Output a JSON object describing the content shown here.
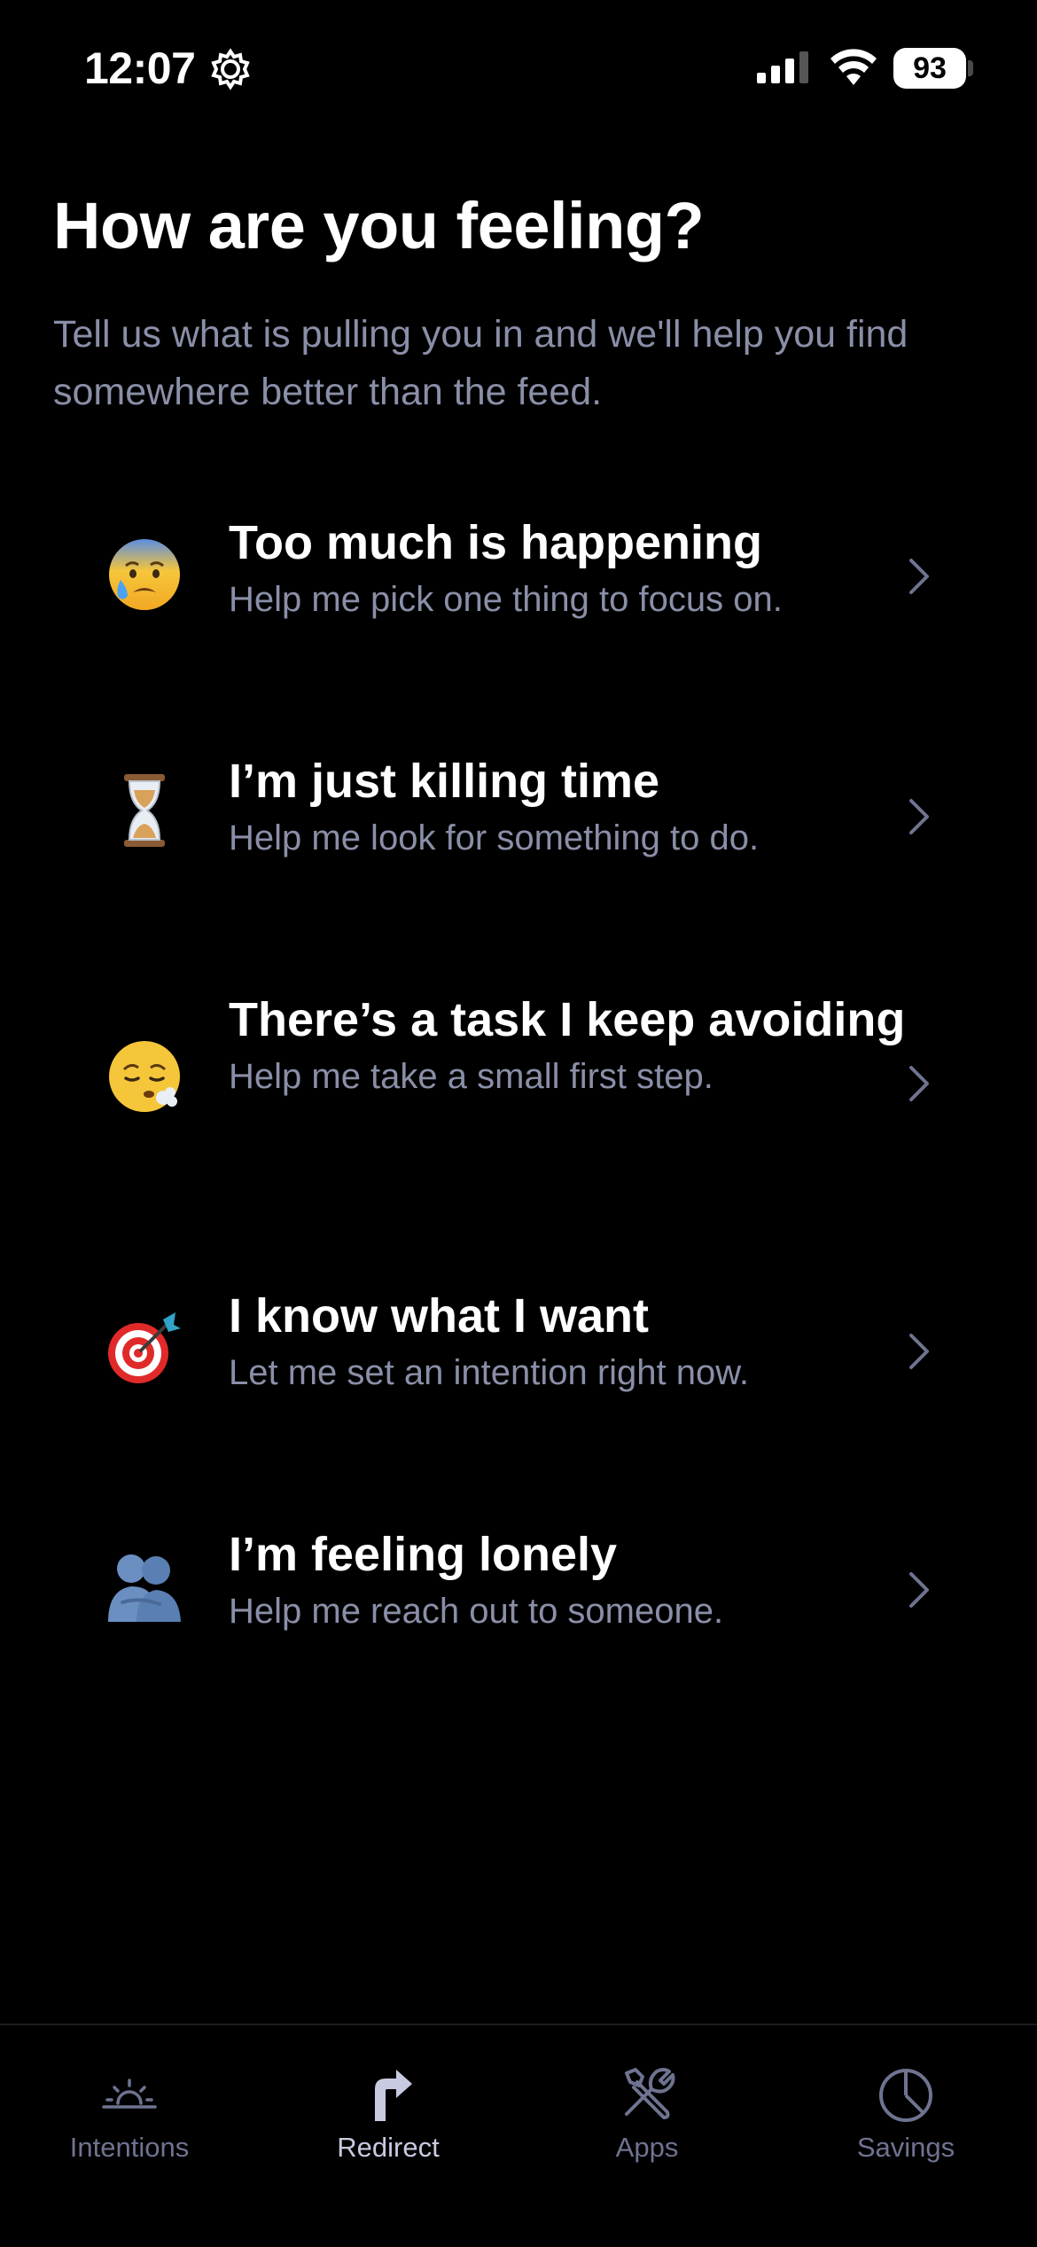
{
  "status_bar": {
    "time": "12:07",
    "battery": "93"
  },
  "header": {
    "title": "How are you feeling?",
    "subtitle": "Tell us what is pulling you in and we'll help you find somewhere better than the feed."
  },
  "options": [
    {
      "emoji": "anxious-sweat-face-icon",
      "title": "Too much is happening",
      "description": "Help me pick one thing to focus on."
    },
    {
      "emoji": "hourglass-icon",
      "title": "I’m just killing time",
      "description": "Help me look for something to do."
    },
    {
      "emoji": "exhale-face-icon",
      "title": "There’s a task I keep avoiding",
      "description": "Help me take a small first step."
    },
    {
      "emoji": "target-dart-icon",
      "title": "I know what I want",
      "description": "Let me set an intention right now."
    },
    {
      "emoji": "hugging-people-icon",
      "title": "I’m feeling lonely",
      "description": "Help me reach out to someone."
    }
  ],
  "tab_bar": {
    "tabs": [
      {
        "label": "Intentions",
        "icon": "sunrise-icon",
        "active": false
      },
      {
        "label": "Redirect",
        "icon": "redirect-arrow-icon",
        "active": true
      },
      {
        "label": "Apps",
        "icon": "tools-icon",
        "active": false
      },
      {
        "label": "Savings",
        "icon": "pie-chart-icon",
        "active": false
      }
    ]
  },
  "colors": {
    "background": "#000000",
    "muted_text": "#8a8fa8",
    "tab_inactive": "#6e7390",
    "tab_active": "#c7cae0"
  }
}
